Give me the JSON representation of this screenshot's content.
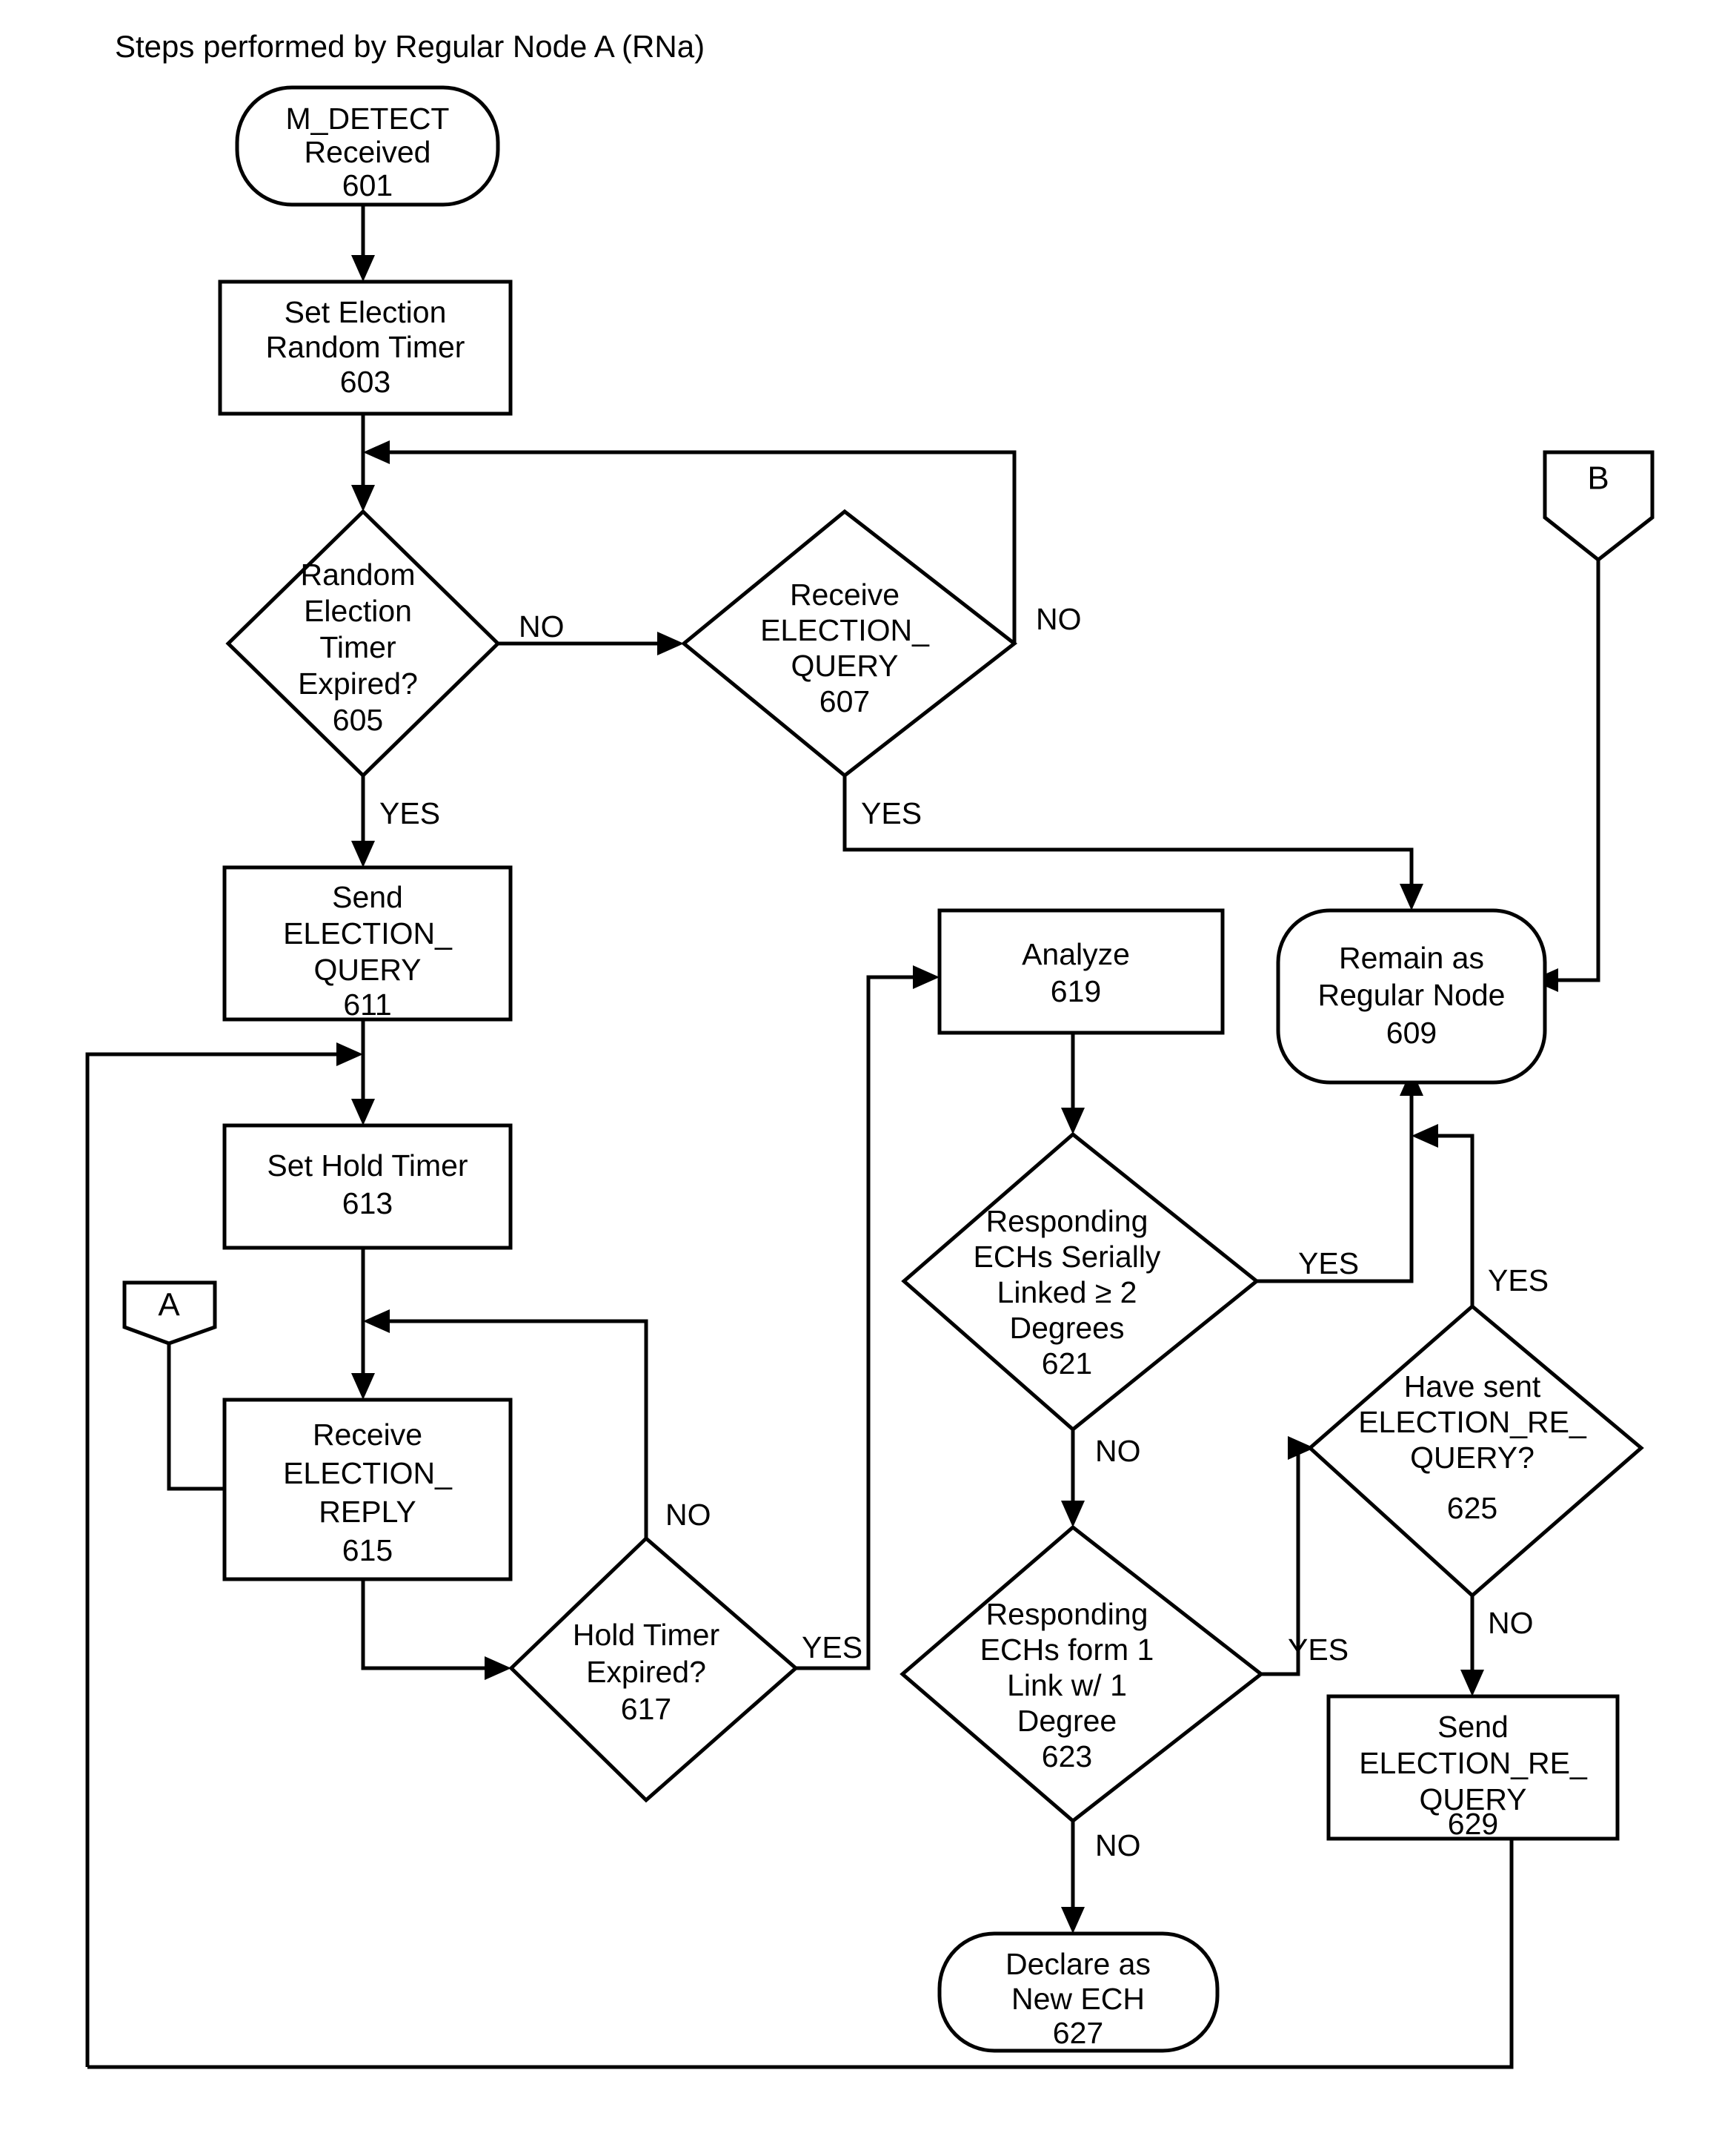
{
  "figure": {
    "title": "Steps performed by Regular Node A (RNa)"
  },
  "nodes": {
    "n601": {
      "shape": "terminator",
      "lines": [
        "M_DETECT",
        "Received",
        "601"
      ],
      "ref": "601"
    },
    "n603": {
      "shape": "process",
      "lines": [
        "Set Election",
        "Random Timer",
        "603"
      ],
      "ref": "603"
    },
    "n605": {
      "shape": "decision",
      "lines": [
        "Random",
        "Election",
        "Timer",
        "Expired?",
        "605"
      ],
      "ref": "605"
    },
    "n607": {
      "shape": "decision",
      "lines": [
        "Receive",
        "ELECTION_",
        "QUERY",
        "607"
      ],
      "ref": "607"
    },
    "n609": {
      "shape": "terminator",
      "lines": [
        "Remain as",
        "Regular Node",
        "609"
      ],
      "ref": "609"
    },
    "n611": {
      "shape": "process",
      "lines": [
        "Send",
        "ELECTION_",
        "QUERY",
        "611"
      ],
      "ref": "611"
    },
    "n613": {
      "shape": "process",
      "lines": [
        "Set Hold Timer",
        "613"
      ],
      "ref": "613"
    },
    "n615": {
      "shape": "process",
      "lines": [
        "Receive",
        "ELECTION_",
        "REPLY",
        "615"
      ],
      "ref": "615"
    },
    "n617": {
      "shape": "decision",
      "lines": [
        "Hold Timer",
        "Expired?",
        "617"
      ],
      "ref": "617"
    },
    "n619": {
      "shape": "process",
      "lines": [
        "Analyze",
        "619"
      ],
      "ref": "619"
    },
    "n621": {
      "shape": "decision",
      "lines": [
        "Responding",
        "ECHs Serially",
        "Linked ≥ 2",
        "Degrees",
        "621"
      ],
      "ref": "621"
    },
    "n623": {
      "shape": "decision",
      "lines": [
        "Responding",
        "ECHs form 1",
        "Link w/ 1",
        "Degree",
        "623"
      ],
      "ref": "623"
    },
    "n625": {
      "shape": "decision",
      "lines": [
        "Have sent",
        "ELECTION_RE_",
        "QUERY?",
        "625"
      ],
      "ref": "625"
    },
    "n627": {
      "shape": "terminator",
      "lines": [
        "Declare as",
        "New ECH",
        "627"
      ],
      "ref": "627"
    },
    "n629": {
      "shape": "process",
      "lines": [
        "Send",
        "ELECTION_RE_",
        "QUERY",
        "629"
      ],
      "ref": "629"
    }
  },
  "connectors": {
    "a": {
      "label": "A"
    },
    "b": {
      "label": "B"
    }
  },
  "edge_labels": {
    "e605_no": "NO",
    "e605_yes": "YES",
    "e607_no": "NO",
    "e607_yes": "YES",
    "e617_no": "NO",
    "e617_yes": "YES",
    "e621_yes": "YES",
    "e621_no": "NO",
    "e623_yes": "YES",
    "e623_no": "NO",
    "e625_yes": "YES",
    "e625_no": "NO"
  },
  "style": {
    "stroke": "#000000",
    "fill": "#ffffff",
    "background": "#ffffff"
  }
}
